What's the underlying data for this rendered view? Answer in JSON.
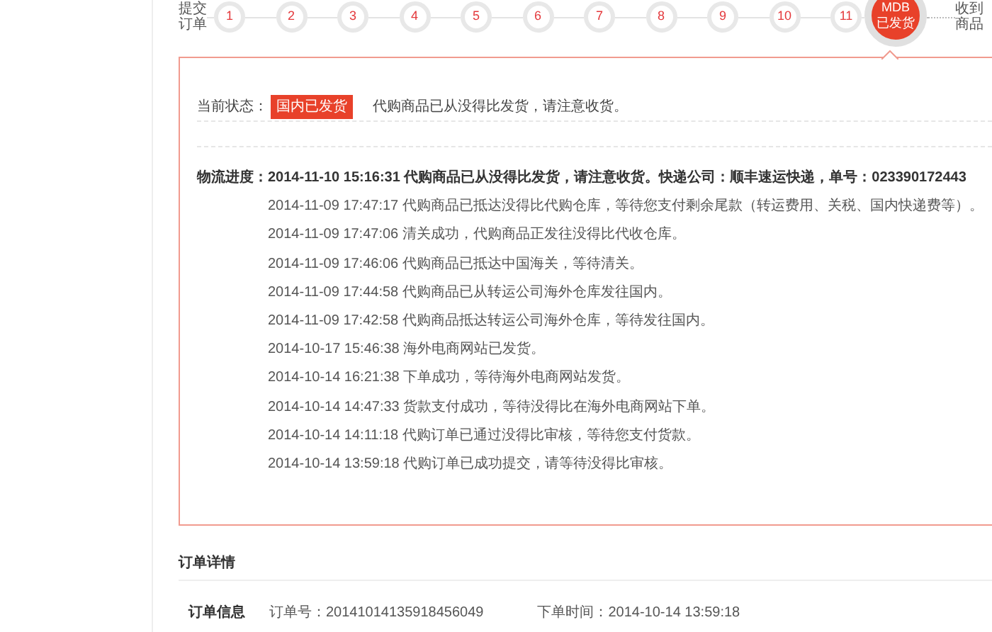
{
  "progress": {
    "start_label": [
      "提交",
      "订单"
    ],
    "steps": [
      {
        "label": "1",
        "current": false
      },
      {
        "label": "2",
        "current": false
      },
      {
        "label": "3",
        "current": false
      },
      {
        "label": "4",
        "current": false
      },
      {
        "label": "5",
        "current": false
      },
      {
        "label": "6",
        "current": false
      },
      {
        "label": "7",
        "current": false
      },
      {
        "label": "8",
        "current": false
      },
      {
        "label": "9",
        "current": false
      },
      {
        "label": "10",
        "current": false
      },
      {
        "label": "11",
        "current": false
      },
      {
        "label": "MDB",
        "sublabel": "已发货",
        "current": true
      }
    ],
    "end_label": [
      "收到",
      "商品"
    ]
  },
  "status": {
    "label": "当前状态：",
    "badge": "国内已发货",
    "message": "代购商品已从没得比发货，请注意收货。"
  },
  "logistics": {
    "label": "物流进度：",
    "entries": [
      {
        "text": "2014-11-10 15:16:31 代购商品已从没得比发货，请注意收货。快递公司：顺丰速运快递，单号：023390172443",
        "latest": true
      },
      {
        "text": "2014-11-09 17:47:17 代购商品已抵达没得比代购仓库，等待您支付剩余尾款（转运费用、关税、国内快递费等）。",
        "latest": false
      },
      {
        "text": "2014-11-09 17:47:06 清关成功，代购商品正发往没得比代收仓库。",
        "latest": false
      },
      {
        "text": "2014-11-09 17:46:06 代购商品已抵达中国海关，等待清关。",
        "latest": false
      },
      {
        "text": "2014-11-09 17:44:58 代购商品已从转运公司海外仓库发往国内。",
        "latest": false
      },
      {
        "text": "2014-11-09 17:42:58 代购商品抵达转运公司海外仓库，等待发往国内。",
        "latest": false
      },
      {
        "text": "2014-10-17 15:46:38 海外电商网站已发货。",
        "latest": false
      },
      {
        "text": "2014-10-14 16:21:38 下单成功，等待海外电商网站发货。",
        "latest": false
      },
      {
        "text": "2014-10-14 14:47:33 货款支付成功，等待没得比在海外电商网站下单。",
        "latest": false
      },
      {
        "text": "2014-10-14 14:11:18 代购订单已通过没得比审核，等待您支付货款。",
        "latest": false
      },
      {
        "text": "2014-10-14 13:59:18 代购订单已成功提交，请等待没得比审核。",
        "latest": false
      }
    ]
  },
  "order_details": {
    "title": "订单详情",
    "rows": [
      {
        "label": "订单信息",
        "fields": [
          "订单号：20141014135918456049",
          "下单时间：2014-10-14 13:59:18"
        ]
      }
    ]
  }
}
